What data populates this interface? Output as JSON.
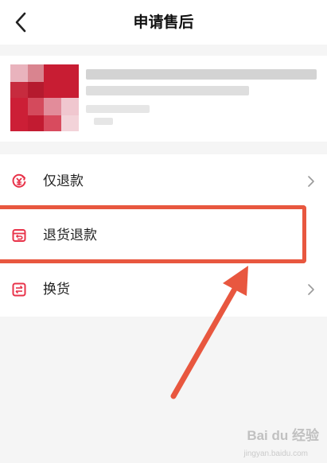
{
  "header": {
    "title": "申请售后"
  },
  "options": [
    {
      "label": "仅退款",
      "icon": "yen-refund-icon",
      "icon_color": "#e8334a"
    },
    {
      "label": "退货退款",
      "icon": "return-box-icon",
      "icon_color": "#e8334a"
    },
    {
      "label": "换货",
      "icon": "exchange-icon",
      "icon_color": "#e8334a"
    }
  ],
  "watermark": {
    "brand": "Bai du 经验",
    "sub": "jingyan.baidu.com"
  },
  "colors": {
    "accent": "#e8334a",
    "annotation": "#e8573f",
    "background": "#f5f5f5"
  }
}
